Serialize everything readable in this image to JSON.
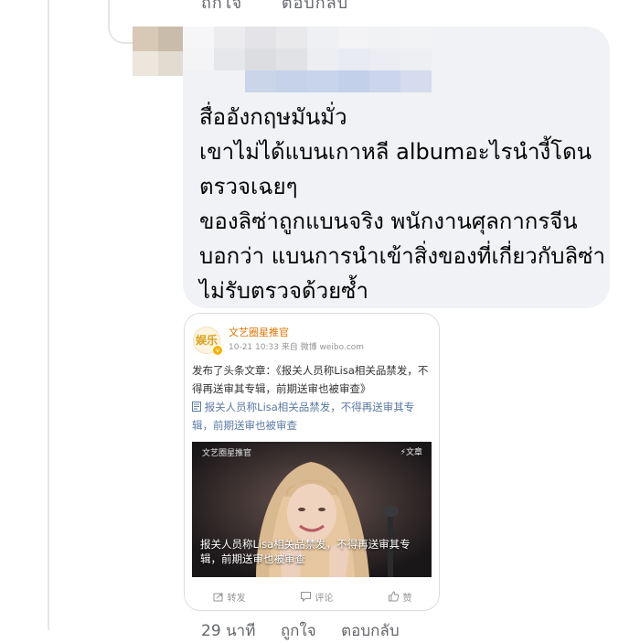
{
  "previous_comment": {
    "actions": [
      "ถูกใจ",
      "ตอบกลับ"
    ]
  },
  "comment": {
    "lines": [
      "สื่ออังกฤษมันมั่ว",
      "เขาไม่ได้แบนเกาหลี albumอะไรนำงี้โดน",
      "ตรวจเฉยๆ",
      "ของลิซ่าถูกแบนจริง พนักงานศุลกากรจีน",
      "บอกว่า แบนการนำเข้าสิ่งของที่เกี่ยวกับลิซ่า",
      "ไม่รับตรวจด้วยซ้ำ"
    ],
    "footer": {
      "time": "29 นาที",
      "like": "ถูกใจ",
      "reply": "ตอบกลับ"
    }
  },
  "weibo_card": {
    "logo_text": "娱乐",
    "account_name": "文艺圈星推官",
    "meta": "10-21 10:33 来自 微博 weibo.com",
    "post_text": "发布了头条文章：《报关人员称Lisa相关品禁发，不得再送审其专辑，前期送审也被审查》",
    "link_icon": "article-icon",
    "link_text": "报关人员称Lisa相关品禁发，不得再送审其专辑，前期送审也被审查",
    "image": {
      "account": "文艺圈星推官",
      "tag": "⚡文章",
      "caption": "报关人员称Lisa相关品禁发，不得再送审其专辑，前期送审也被审查"
    },
    "actions": {
      "repost": "转发",
      "comment": "评论",
      "like": "赞"
    }
  },
  "colors": {
    "bubble_bg": "#f0f2f5",
    "link": "#5b7aa6",
    "account_orange": "#e07400",
    "muted": "#65676b"
  }
}
